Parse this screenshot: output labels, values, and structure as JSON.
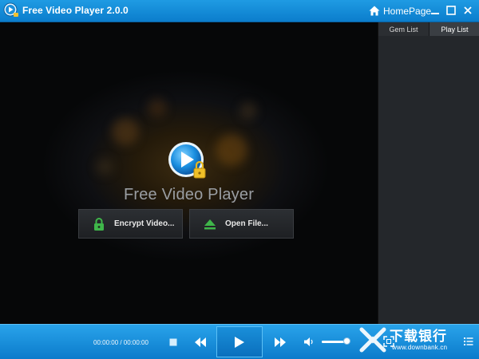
{
  "window": {
    "title": "Free Video Player 2.0.0",
    "home_label": "HomePage",
    "accent": "#1690dc"
  },
  "icons": {
    "app": "player-icon",
    "home": "home-icon",
    "minimize": "minimize-icon",
    "maximize": "maximize-icon",
    "close": "close-icon",
    "encrypt": "lock-icon",
    "open": "eject-icon",
    "stop": "stop-icon",
    "prev": "previous-icon",
    "play": "play-icon",
    "next": "next-icon",
    "volume": "speaker-icon",
    "fullscreen": "fullscreen-icon",
    "playlist": "list-icon"
  },
  "player": {
    "brand_text": "Free Video Player",
    "encrypt_label": "Encrypt Video...",
    "open_label": "Open File..."
  },
  "sidebar": {
    "tabs": [
      {
        "label": "Gem List",
        "active": false
      },
      {
        "label": "Play List",
        "active": true
      }
    ]
  },
  "controls": {
    "time_display": "00:00:00 / 00:00:00",
    "volume_level": 0.85
  },
  "watermark": {
    "text": "下载银行",
    "url": "www.downbank.cn"
  }
}
